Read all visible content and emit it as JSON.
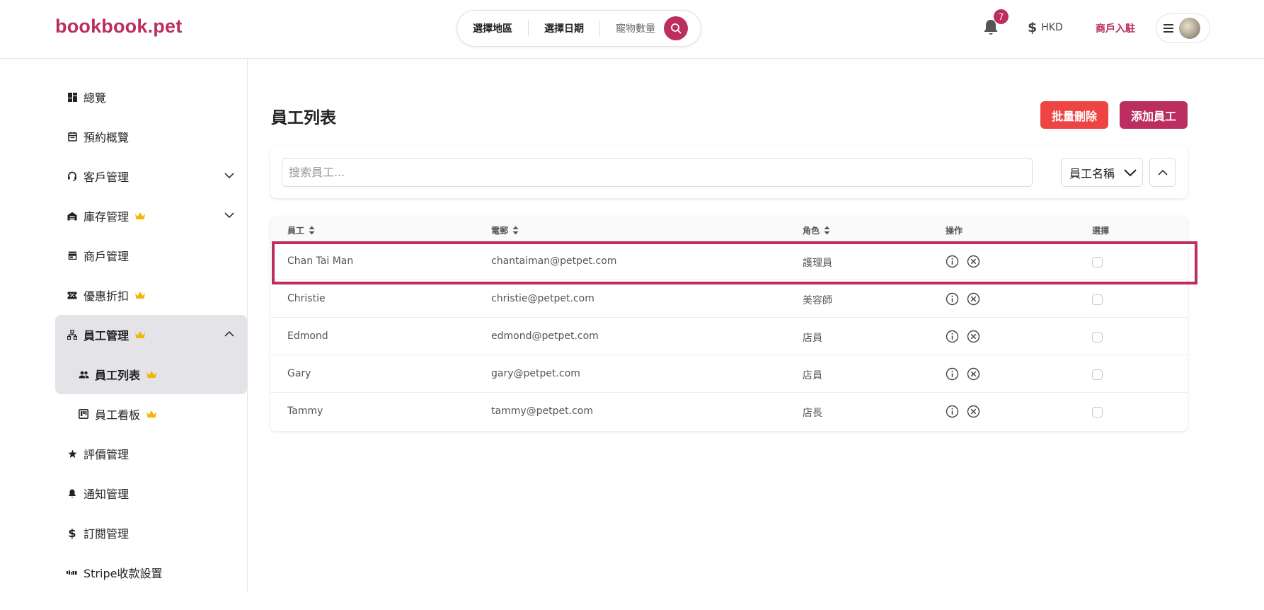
{
  "header": {
    "logo": "bookbook.pet",
    "search": {
      "location": "選擇地區",
      "date": "選擇日期",
      "pets": "寵物數量"
    },
    "notifications_count": "7",
    "currency": "HKD",
    "merchant_link": "商戶入駐",
    "colors": {
      "brand": "#bb2e5f"
    }
  },
  "sidebar": {
    "items": [
      {
        "label": "總覽",
        "icon": "dashboard-icon"
      },
      {
        "label": "預約概覽",
        "icon": "calendar-icon"
      },
      {
        "label": "客戶管理",
        "icon": "headset-icon"
      },
      {
        "label": "庫存管理",
        "icon": "warehouse-icon"
      },
      {
        "label": "商戶管理",
        "icon": "store-icon"
      },
      {
        "label": "優惠折扣",
        "icon": "ticket-icon"
      },
      {
        "label": "員工管理",
        "icon": "org-chart-icon"
      },
      {
        "label": "員工列表",
        "icon": "people-icon"
      },
      {
        "label": "員工看板",
        "icon": "kanban-icon"
      },
      {
        "label": "評價管理",
        "icon": "star-icon"
      },
      {
        "label": "通知管理",
        "icon": "bell-icon"
      },
      {
        "label": "訂閱管理",
        "icon": "dollar-icon"
      },
      {
        "label": "Stripe收款設置",
        "icon": "stripe-icon"
      }
    ]
  },
  "main": {
    "title": "員工列表",
    "bulk_delete_label": "批量刪除",
    "add_staff_label": "添加員工",
    "search_placeholder": "搜索員工...",
    "sort_field": "員工名稱",
    "columns": {
      "staff": "員工",
      "email": "電郵",
      "role": "角色",
      "actions": "操作",
      "select": "選擇"
    },
    "rows": [
      {
        "name": "Chan Tai Man",
        "email": "chantaiman@petpet.com",
        "role": "護理員"
      },
      {
        "name": "Christie",
        "email": "christie@petpet.com",
        "role": "美容師"
      },
      {
        "name": "Edmond",
        "email": "edmond@petpet.com",
        "role": "店員"
      },
      {
        "name": "Gary",
        "email": "gary@petpet.com",
        "role": "店員"
      },
      {
        "name": "Tammy",
        "email": "tammy@petpet.com",
        "role": "店長"
      }
    ]
  }
}
